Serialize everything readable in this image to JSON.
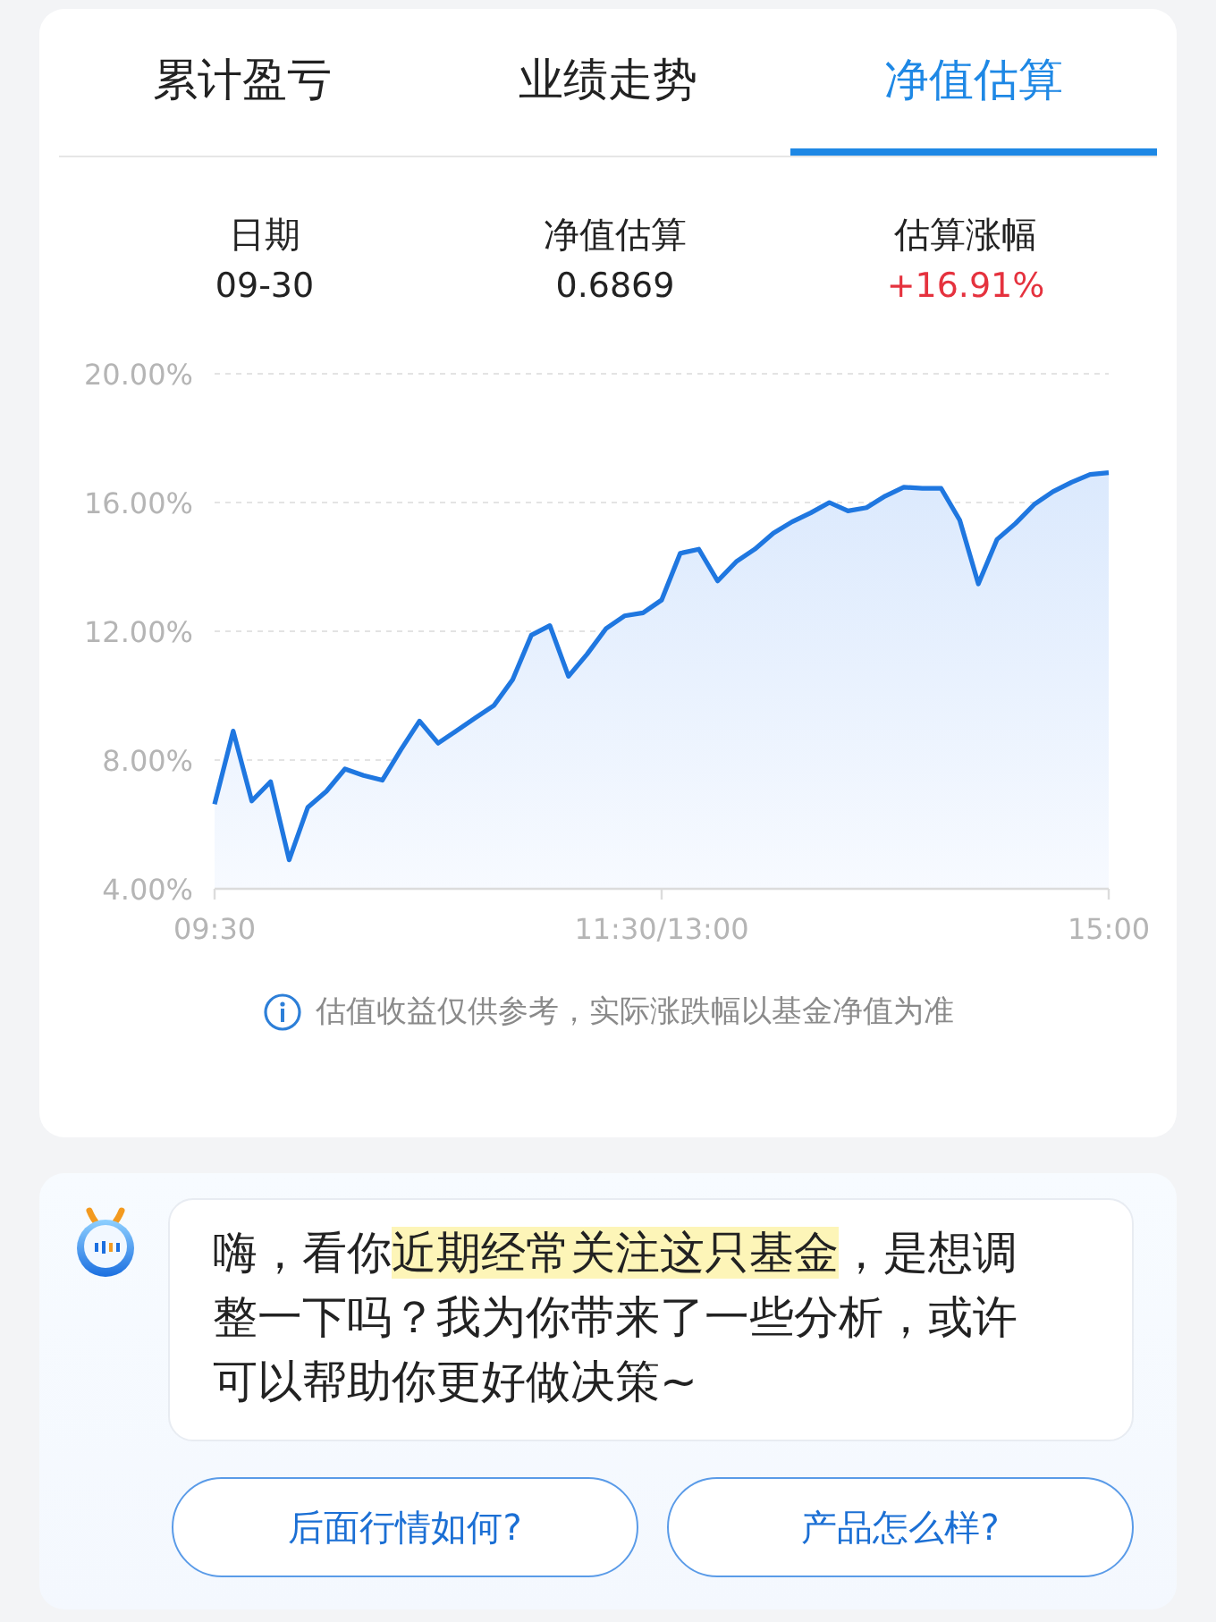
{
  "tabs": [
    {
      "label": "累计盈亏",
      "selected": false
    },
    {
      "label": "业绩走势",
      "selected": false
    },
    {
      "label": "净值估算",
      "selected": true
    }
  ],
  "stats": [
    {
      "label": "日期",
      "value": "09-30",
      "rising": false
    },
    {
      "label": "净值估算",
      "value": "0.6869",
      "rising": false
    },
    {
      "label": "估算涨幅",
      "value": "+16.91%",
      "rising": true
    }
  ],
  "chart_data": {
    "type": "area",
    "grid": true,
    "ylim": [
      4,
      20
    ],
    "yticks": [
      {
        "value": 4,
        "label": "4.00%"
      },
      {
        "value": 8,
        "label": "8.00%"
      },
      {
        "value": 12,
        "label": "12.00%"
      },
      {
        "value": 16,
        "label": "16.00%"
      },
      {
        "value": 20,
        "label": "20.00%"
      }
    ],
    "categories": [
      "09:30",
      null,
      null,
      null,
      null,
      null,
      null,
      null,
      null,
      null,
      null,
      null,
      null,
      null,
      null,
      null,
      null,
      null,
      null,
      null,
      null,
      null,
      null,
      null,
      "11:30/13:00",
      null,
      null,
      null,
      null,
      null,
      null,
      null,
      null,
      null,
      null,
      null,
      null,
      null,
      null,
      null,
      null,
      null,
      null,
      null,
      null,
      null,
      null,
      null,
      "15:00"
    ],
    "series": [
      {
        "color": "#1f77e0",
        "values": [
          6.63,
          8.9,
          6.73,
          7.33,
          4.9,
          6.53,
          7.03,
          7.72,
          7.52,
          7.37,
          8.32,
          9.21,
          8.52,
          8.91,
          9.31,
          9.7,
          10.5,
          11.88,
          12.18,
          10.6,
          11.29,
          12.08,
          12.48,
          12.57,
          12.97,
          14.42,
          14.55,
          13.56,
          14.16,
          14.55,
          15.05,
          15.4,
          15.68,
          16.0,
          15.74,
          15.84,
          16.2,
          16.48,
          16.44,
          16.44,
          15.45,
          13.47,
          14.85,
          15.35,
          15.94,
          16.34,
          16.63,
          16.87,
          16.93
        ]
      }
    ]
  },
  "note": "估值收益仅供参考，实际涨跌幅以基金净值为准",
  "assistant": {
    "message": [
      {
        "text": "嗨，看你",
        "highlighted": false
      },
      {
        "text": "近期经常关注这只基金",
        "highlighted": true
      },
      {
        "text": "，是想调整一下吗？我为你带来了一些分析，或许可以帮助你更好做决策~",
        "highlighted": false
      }
    ],
    "suggestions": [
      "后面行情如何?",
      "产品怎么样?"
    ]
  }
}
